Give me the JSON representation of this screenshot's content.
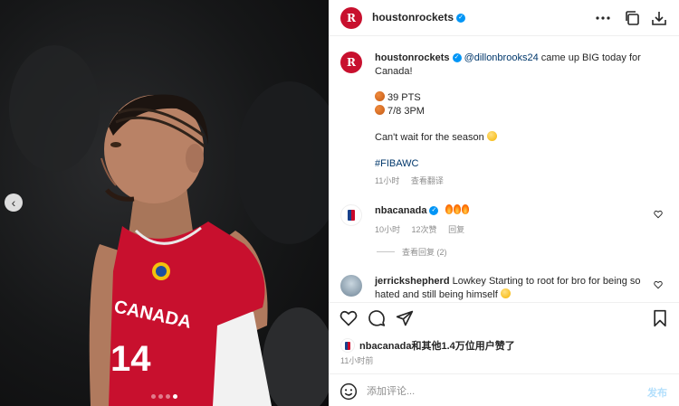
{
  "header": {
    "username": "houstonrockets",
    "icons": [
      "more-icon",
      "copy-icon",
      "download-icon"
    ]
  },
  "photo": {
    "dots_count": 4,
    "active_dot": 3,
    "jersey_text": "CANADA",
    "jersey_number": "14"
  },
  "caption": {
    "username": "houstonrockets",
    "mention": "@dillonbrooks24",
    "line1_rest": " came up BIG today for Canada!",
    "stat1": "39 PTS",
    "stat2": "7/8 3PM",
    "line3": "Can't wait for the season",
    "hashtag": "#FIBAWC",
    "time": "11小时",
    "translate": "查看翻译"
  },
  "comments": [
    {
      "username": "nbacanada",
      "time": "10小时",
      "likes": "12次赞",
      "reply": "回复"
    },
    {
      "username": "jerrickshepherd",
      "text": "Lowkey Starting to root for bro for being so hated and still being himself"
    }
  ],
  "view_replies": "查看回复 (2)",
  "likes_line": "nbacanada和其他1.4万位用户赞了",
  "posted": "11小时前",
  "add_comment": {
    "placeholder": "添加评论...",
    "post_label": "发布"
  },
  "colors": {
    "rockets_red": "#c8102e",
    "verified_blue": "#0095f6",
    "link_blue": "#00376b"
  }
}
